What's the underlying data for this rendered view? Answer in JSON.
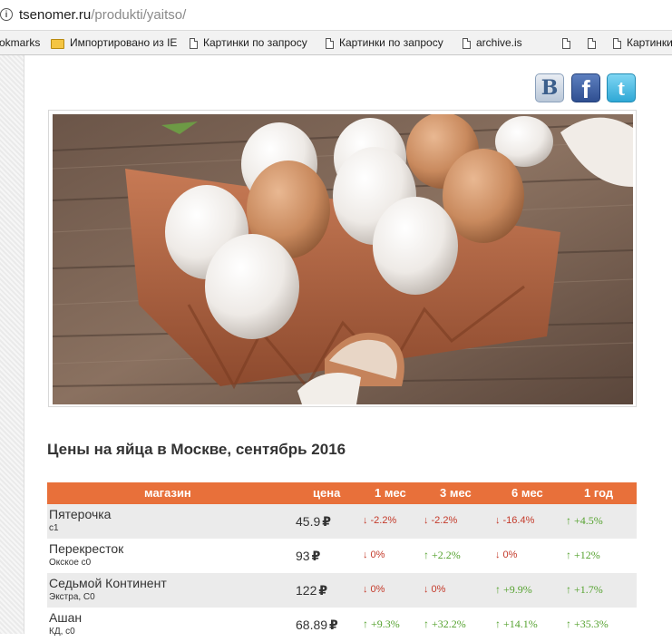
{
  "browser": {
    "url_host": "tsenomer.ru",
    "url_path": "/produkti/yaitso/",
    "bookmarks": [
      {
        "label": "okmarks",
        "icon": "none"
      },
      {
        "label": "Импортировано из IE",
        "icon": "folder-icon"
      },
      {
        "label": "Картинки по запросу",
        "icon": "doc-icon"
      },
      {
        "label": "Картинки по запросу",
        "icon": "doc-icon"
      },
      {
        "label": "archive.is",
        "icon": "doc-icon"
      },
      {
        "label": "",
        "icon": "doc-icon"
      },
      {
        "label": "",
        "icon": "doc-icon"
      },
      {
        "label": "Картинки",
        "icon": "doc-icon"
      }
    ]
  },
  "social": {
    "vk": "B",
    "fb": "f",
    "tw": "t"
  },
  "heading": "Цены на яйца в Москве, сентябрь 2016",
  "table": {
    "headers": {
      "store": "магазин",
      "price": "цена",
      "m1": "1 мес",
      "m3": "3 мес",
      "m6": "6 мес",
      "y1": "1 год"
    },
    "currency": "₽",
    "rows": [
      {
        "store": "Пятерочка",
        "sub": "с1",
        "price": "45.9",
        "m1": {
          "dir": "down",
          "text": "-2.2%"
        },
        "m3": {
          "dir": "down",
          "text": "-2.2%"
        },
        "m6": {
          "dir": "down",
          "text": "-16.4%"
        },
        "y1": {
          "dir": "up",
          "text": "+4.5%"
        }
      },
      {
        "store": "Перекресток",
        "sub": "Окское с0",
        "price": "93",
        "m1": {
          "dir": "down",
          "text": "0%"
        },
        "m3": {
          "dir": "up",
          "text": "+2.2%"
        },
        "m6": {
          "dir": "down",
          "text": "0%"
        },
        "y1": {
          "dir": "up",
          "text": "+12%"
        }
      },
      {
        "store": "Седьмой Континент",
        "sub": "Экстра, С0",
        "price": "122",
        "m1": {
          "dir": "down",
          "text": "0%"
        },
        "m3": {
          "dir": "down",
          "text": "0%"
        },
        "m6": {
          "dir": "up",
          "text": "+9.9%"
        },
        "y1": {
          "dir": "up",
          "text": "+1.7%"
        }
      },
      {
        "store": "Ашан",
        "sub": "КД, с0",
        "price": "68.89",
        "m1": {
          "dir": "up",
          "text": "+9.3%"
        },
        "m3": {
          "dir": "up",
          "text": "+32.2%"
        },
        "m6": {
          "dir": "up",
          "text": "+14.1%"
        },
        "y1": {
          "dir": "up",
          "text": "+35.3%"
        }
      }
    ]
  },
  "colors": {
    "header_orange": "#e8703a",
    "up_green": "#55a22f",
    "down_red": "#c43a2a"
  }
}
